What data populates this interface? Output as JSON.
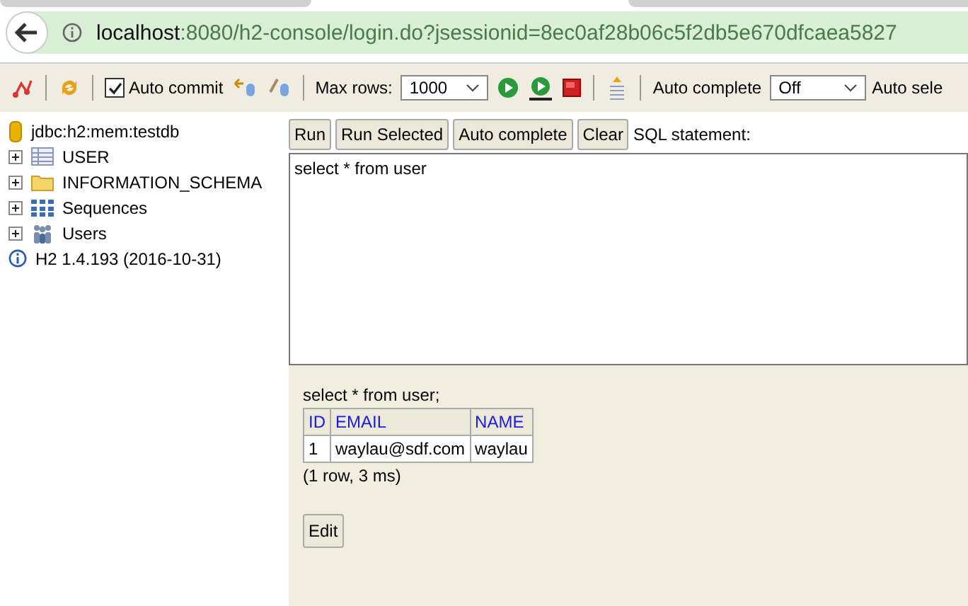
{
  "address_bar": {
    "host": "localhost",
    "path": ":8080/h2-console/login.do?jsessionid=8ec0af28b06c5f2db5e670dfcaea5827"
  },
  "toolbar": {
    "auto_commit": {
      "label": "Auto commit",
      "checked": true
    },
    "max_rows": {
      "label": "Max rows:",
      "value": "1000"
    },
    "auto_complete": {
      "label": "Auto complete",
      "value": "Off"
    },
    "cut_label": "Auto sele"
  },
  "tree": {
    "connection": "jdbc:h2:mem:testdb",
    "items": [
      {
        "kind": "table",
        "label": "USER",
        "expanded": false
      },
      {
        "kind": "folder",
        "label": "INFORMATION_SCHEMA",
        "expanded": false
      },
      {
        "kind": "sequences",
        "label": "Sequences",
        "expanded": false
      },
      {
        "kind": "users",
        "label": "Users",
        "expanded": false
      }
    ],
    "version": "H2 1.4.193 (2016-10-31)"
  },
  "query_buttons": [
    "Run",
    "Run Selected",
    "Auto complete",
    "Clear"
  ],
  "sql_label": "SQL statement:",
  "sql": "select * from user",
  "result": {
    "statement": "select * from user;",
    "columns": [
      "ID",
      "EMAIL",
      "NAME"
    ],
    "rows": [
      [
        "1",
        "waylau@sdf.com",
        "waylau"
      ]
    ],
    "summary": "(1 row, 3 ms)",
    "edit_button": "Edit"
  }
}
